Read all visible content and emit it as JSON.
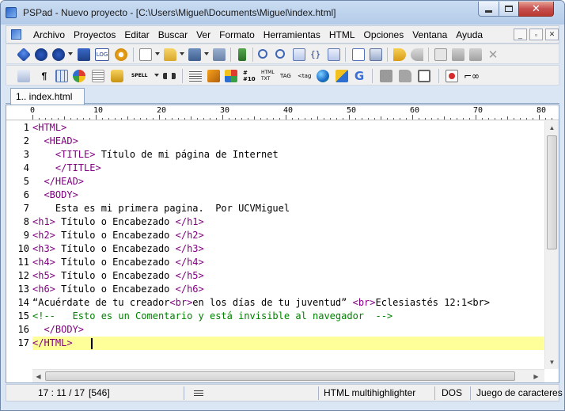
{
  "window": {
    "title": "PSPad - Nuevo proyecto - [C:\\Users\\Miguel\\Documents\\Miguel\\index.html]",
    "controls": {
      "minimize": "_",
      "maximize": "□",
      "close": "✕"
    }
  },
  "menu": {
    "items": [
      "Archivo",
      "Proyectos",
      "Editar",
      "Buscar",
      "Ver",
      "Formato",
      "Herramientas",
      "HTML",
      "Opciones",
      "Ventana",
      "Ayuda"
    ],
    "mdi_minimize": "_",
    "mdi_restore": "▫",
    "mdi_close": "✕"
  },
  "toolbar1_icons": [
    "stop-icon",
    "open-project-icon",
    "save-project-icon",
    "close-project-icon",
    "log-icon",
    "settings-icon",
    "new-file-icon",
    "open-file-icon",
    "save-file-icon",
    "save-all-icon",
    "compile-icon",
    "find-icon",
    "replace-icon",
    "find-in-files-icon",
    "braces-icon",
    "macro-icon",
    "preview-icon",
    "print-icon",
    "undo-icon",
    "redo-icon",
    "cut-icon",
    "copy-icon",
    "paste-icon",
    "delete-icon"
  ],
  "toolbar1_labels": {
    "log": "LOG"
  },
  "toolbar2_icons": [
    "format-icon",
    "pilcrow-icon",
    "table-icon",
    "colors-icon",
    "list-icon",
    "lock-icon",
    "spell-icon",
    "bookmark-icon",
    "indent-icon",
    "box-icon",
    "palette-icon",
    "numbering-icon",
    "html-txt-icon",
    "tag-icon",
    "tag-select-icon",
    "globe-icon",
    "validate-icon",
    "google-icon",
    "block1-icon",
    "block2-icon",
    "window-icon",
    "record-icon",
    "glasses-icon"
  ],
  "toolbar2_labels": {
    "spell": "SPELL",
    "html": "HTML",
    "txt": "TXT",
    "tag": "TAG",
    "tag2": "<tag"
  },
  "tabs": [
    {
      "label": "1.. index.html"
    }
  ],
  "ruler": {
    "labels": [
      "0",
      "10",
      "20",
      "30",
      "40",
      "50",
      "60",
      "70",
      "80"
    ]
  },
  "editor": {
    "active_line": 17,
    "lines": [
      {
        "n": "1",
        "a": "<HTML>",
        "b": "",
        "c": "",
        "d": "",
        "e": "",
        "f": ""
      },
      {
        "n": "2",
        "a": "  <HEAD>",
        "b": "",
        "c": "",
        "d": "",
        "e": "",
        "f": ""
      },
      {
        "n": "3",
        "a": "    <TITLE>",
        "b": " Título de mi página de Internet",
        "c": "",
        "d": "",
        "e": "",
        "f": ""
      },
      {
        "n": "4",
        "a": "    </TITLE>",
        "b": "",
        "c": "",
        "d": "",
        "e": "",
        "f": ""
      },
      {
        "n": "5",
        "a": "  </HEAD>",
        "b": "",
        "c": "",
        "d": "",
        "e": "",
        "f": ""
      },
      {
        "n": "6",
        "a": "  <BODY>",
        "b": "",
        "c": "",
        "d": "",
        "e": "",
        "f": ""
      },
      {
        "n": "7",
        "a": "",
        "b": "    Esta es mi primera pagina.  Por UCVMiguel",
        "c": "",
        "d": "",
        "e": "",
        "f": ""
      },
      {
        "n": "8",
        "a": "<h1>",
        "b": " Título o Encabezado ",
        "c": "</h1>",
        "d": "",
        "e": "",
        "f": ""
      },
      {
        "n": "9",
        "a": "<h2>",
        "b": " Título o Encabezado ",
        "c": "</h2>",
        "d": "",
        "e": "",
        "f": ""
      },
      {
        "n": "10",
        "a": "<h3>",
        "b": " Título o Encabezado ",
        "c": "</h3>",
        "d": "",
        "e": "",
        "f": ""
      },
      {
        "n": "11",
        "a": "<h4>",
        "b": " Título o Encabezado ",
        "c": "</h4>",
        "d": "",
        "e": "",
        "f": ""
      },
      {
        "n": "12",
        "a": "<h5>",
        "b": " Título o Encabezado ",
        "c": "</h5>",
        "d": "",
        "e": "",
        "f": ""
      },
      {
        "n": "13",
        "a": "<h6>",
        "b": " Título o Encabezado ",
        "c": "</h6>",
        "d": "",
        "e": "",
        "f": ""
      },
      {
        "n": "14",
        "a": "",
        "b": "“Acuérdate de tu creador",
        "c": "<br>",
        "d": "en los días de tu juventud” ",
        "e": "<br>",
        "f": "Eclesiastés 12:1<br>"
      },
      {
        "n": "15",
        "a": "",
        "b": "",
        "c": "",
        "d": "",
        "e": "",
        "f": "",
        "comment": "<!--   Esto es un Comentario y está invisible al navegador  -->"
      },
      {
        "n": "16",
        "a": "  </BODY>",
        "b": "",
        "c": "",
        "d": "",
        "e": "",
        "f": ""
      },
      {
        "n": "17",
        "a": "</HTML>",
        "b": "   ",
        "c": "",
        "d": "",
        "e": "",
        "f": ""
      }
    ]
  },
  "status": {
    "position": "17 : 11 / 17",
    "size": "[546]",
    "highlighter": "HTML multihighlighter",
    "line_ending": "DOS",
    "charset": "Juego de caracteres"
  }
}
